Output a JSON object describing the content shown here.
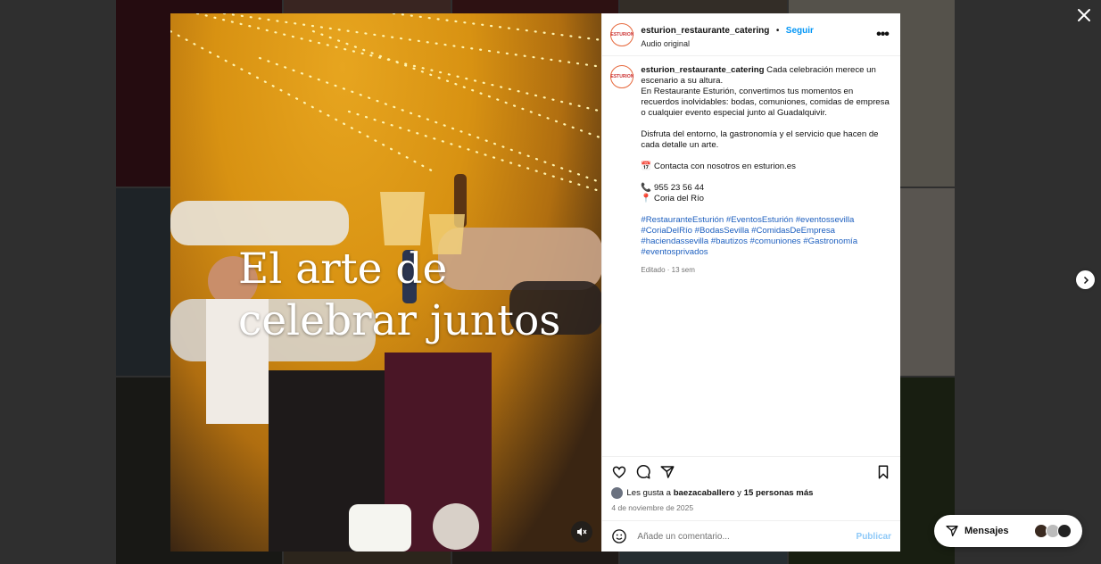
{
  "post": {
    "username": "esturion_restaurante_catering",
    "follow_label": "Seguir",
    "audio": "Audio original",
    "avatar_text": "ESTURION",
    "media_title_line1": "El arte de",
    "media_title_line2": "celebrar juntos",
    "caption": {
      "lead": "Cada celebración merece un escenario a su altura.",
      "line2": "En Restaurante Esturión, convertimos tus momentos en recuerdos inolvidables: bodas, comuniones, comidas de empresa o cualquier evento especial junto al Guadalquivir.",
      "line3": "Disfruta del entorno, la gastronomía y el servicio que hacen de cada detalle un arte.",
      "contact": "📅 Contacta con nosotros en esturion.es",
      "phone": "📞 955 23 56 44",
      "location": "📍 Coria del Río",
      "hashtags": "#RestauranteEsturión #EventosEsturión #eventossevilla #CoriaDelRío #BodasSevilla #ComidasDeEmpresa #haciendassevilla #bautizos #comuniones #Gastronomía #eventosprivados",
      "meta": "Editado · 13 sem"
    },
    "likes_prefix": "Les gusta a",
    "likes_user": "baezacaballero",
    "likes_and": "y",
    "likes_others": "15 personas más",
    "date": "4 de noviembre de 2025",
    "comment_placeholder": "Añade un comentario...",
    "publish_label": "Publicar"
  },
  "messages": {
    "label": "Mensajes"
  },
  "colors": {
    "accent": "#0095f6",
    "hashtag": "#1d5fbf"
  },
  "icons": [
    "close-icon",
    "heart-icon",
    "comment-icon",
    "share-icon",
    "bookmark-icon",
    "emoji-icon",
    "mute-icon",
    "chevron-right-icon",
    "messages-icon",
    "more-icon"
  ]
}
